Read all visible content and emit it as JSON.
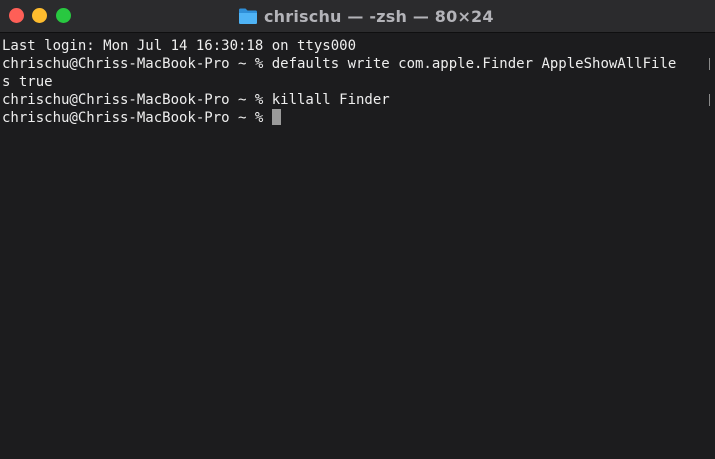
{
  "window": {
    "title": "chrischu — -zsh — 80×24",
    "colors": {
      "close": "#fe5f57",
      "minimize": "#febc2e",
      "zoom": "#28c840",
      "folder": "#3aa6f0",
      "background": "#1c1c1e",
      "text": "#eeeeee"
    },
    "icons": [
      "folder-icon"
    ]
  },
  "terminal": {
    "lines": [
      "Last login: Mon Jul 14 16:30:18 on ttys000",
      "chrischu@Chriss-MacBook-Pro ~ % defaults write com.apple.Finder AppleShowAllFile",
      "s true",
      "chrischu@Chriss-MacBook-Pro ~ % killall Finder"
    ],
    "prompt": "chrischu@Chriss-MacBook-Pro ~ % "
  }
}
